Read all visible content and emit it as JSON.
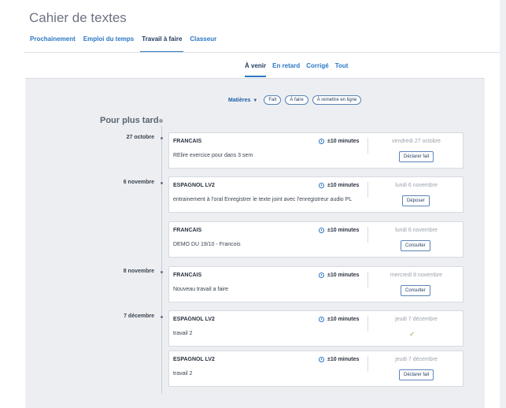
{
  "app": {
    "title": "Cahier de textes"
  },
  "main_tabs": [
    {
      "label": "Prochainement"
    },
    {
      "label": "Emploi du temps"
    },
    {
      "label": "Travail à faire"
    },
    {
      "label": "Classeur"
    }
  ],
  "sub_tabs": [
    {
      "label": "À venir"
    },
    {
      "label": "En retard"
    },
    {
      "label": "Corrigé"
    },
    {
      "label": "Tout"
    }
  ],
  "filters": {
    "subjects_label": "Matières",
    "pills": [
      {
        "label": "Fait"
      },
      {
        "label": "À faire"
      },
      {
        "label": "À remettre en ligne"
      }
    ]
  },
  "section": {
    "title": "Pour plus tard"
  },
  "dates": [
    {
      "label": "27 octobre"
    },
    {
      "label": "6 novembre"
    },
    {
      "label": "8 novembre"
    },
    {
      "label": "7 décembre"
    }
  ],
  "tasks": [
    {
      "subject": "FRANCAIS",
      "duration": "±10 minutes",
      "description": "RElire exercice pour dans 3 sem",
      "due": "vendredi 27 octobre",
      "action": "Déclarer fait"
    },
    {
      "subject": "ESPAGNOL LV2",
      "duration": "±10 minutes",
      "description": "entrainement à l'oral Enregistrer le texte joint avec l'enregistreur audio PL",
      "due": "lundi 6 novembre",
      "action": "Déposer"
    },
    {
      "subject": "FRANCAIS",
      "duration": "±10 minutes",
      "description": "DEMO DU 19/10 - Francois",
      "due": "lundi 6 novembre",
      "action": "Consulter"
    },
    {
      "subject": "FRANCAIS",
      "duration": "±10 minutes",
      "description": "Nouveau travail a faire",
      "due": "mercredi 8 novembre",
      "action": "Consulter"
    },
    {
      "subject": "ESPAGNOL LV2",
      "duration": "±10 minutes",
      "description": "travail 2",
      "due": "jeudi 7 décembre",
      "action": ""
    },
    {
      "subject": "ESPAGNOL LV2",
      "duration": "±10 minutes",
      "description": "travail 2",
      "due": "jeudi 7 décembre",
      "action": "Déclarer fait"
    }
  ],
  "icons": {
    "duration": "clock-icon",
    "done": "checkmark-icon",
    "dropdown": "caret-down-icon"
  },
  "colors": {
    "accent": "#2b78c5",
    "done": "#8ab44a"
  }
}
